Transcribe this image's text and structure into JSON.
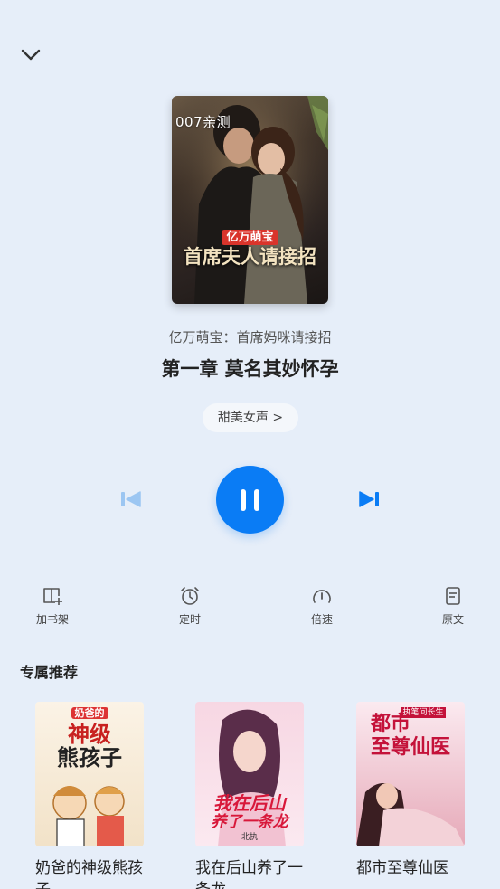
{
  "player": {
    "cover_tag": "007亲测",
    "cover_subtitle": "亿万萌宝",
    "cover_title": "首席夫人请接招",
    "book_name": "亿万萌宝：首席妈咪请接招",
    "chapter_title": "第一章  莫名其妙怀孕",
    "voice": "甜美女声 >",
    "state": "playing"
  },
  "toolbar": [
    {
      "label": "加书架",
      "icon": "bookshelf-add-icon"
    },
    {
      "label": "定时",
      "icon": "alarm-clock-icon"
    },
    {
      "label": "倍速",
      "icon": "speed-gauge-icon"
    },
    {
      "label": "原文",
      "icon": "document-icon"
    }
  ],
  "recommend": {
    "title": "专属推荐",
    "items": [
      {
        "title": "奶爸的神级熊孩子",
        "cover_line1": "奶爸的",
        "cover_line2": "神级",
        "cover_line3": "熊孩子"
      },
      {
        "title": "我在后山养了一条龙",
        "cover_line1": "我在后山",
        "cover_line2": "养了一条龙",
        "cover_line3": "北执"
      },
      {
        "title": "都市至尊仙医",
        "cover_line1": "都市",
        "cover_line2": "至尊仙医",
        "cover_line3": "执笔问长生"
      }
    ]
  },
  "colors": {
    "background": "#e6eef9",
    "accent": "#0a7cf5",
    "prev_disabled": "#9cc6f2"
  }
}
